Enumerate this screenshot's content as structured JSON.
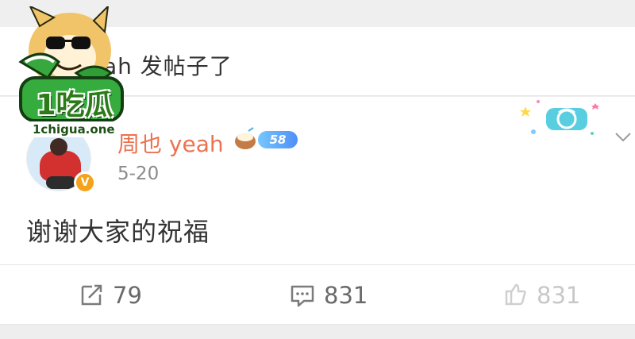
{
  "notice": {
    "text": "ah 发帖子了"
  },
  "post": {
    "user_name": "周也 yeah",
    "level": "58",
    "date": "5-20",
    "content": "谢谢大家的祝福"
  },
  "actions": {
    "share_count": "79",
    "comment_count": "831",
    "like_count": "831"
  },
  "watermark": {
    "title": "1吃瓜",
    "url": "1chigua.one"
  },
  "icons": {
    "share": "share-icon",
    "comment": "comment-icon",
    "like": "like-icon",
    "more": "chevron-down-icon",
    "verified": "verified-badge-icon"
  },
  "colors": {
    "username": "#eb7350",
    "verified_badge": "#f6a11a",
    "level_pill": "#4f8ff7",
    "text_primary": "#333333",
    "text_secondary": "#8b8b8b"
  }
}
